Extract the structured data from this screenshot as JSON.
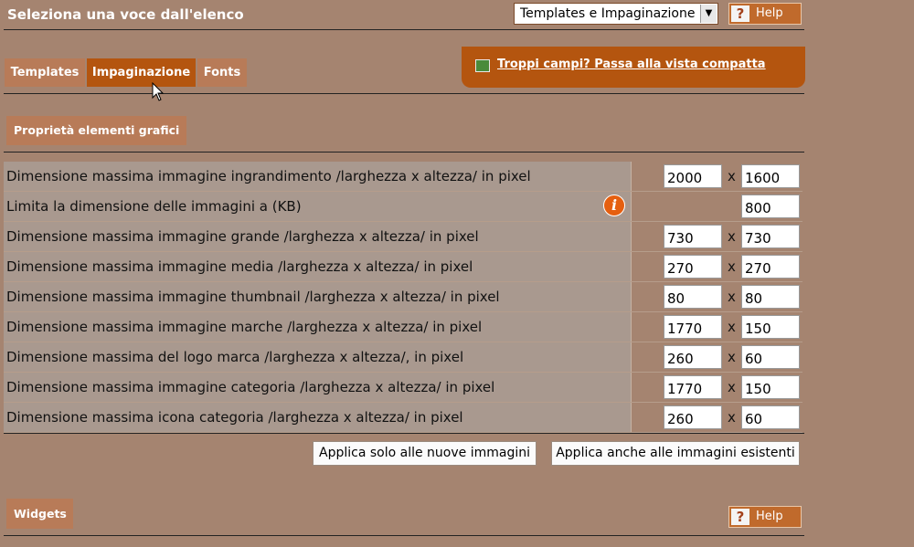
{
  "header": {
    "title": "Seleziona una voce dall'elenco",
    "select_value": "Templates e Impaginazione",
    "help_label": "Help",
    "help_q": "?"
  },
  "tabs": [
    {
      "label": "Templates",
      "active": false
    },
    {
      "label": "Impaginazione",
      "active": true
    },
    {
      "label": "Fonts",
      "active": false
    }
  ],
  "compact_view": {
    "link_text": "Troppi campi? Passa alla vista compatta"
  },
  "properties": {
    "section_title": "Proprietà elementi grafici",
    "times_sign": "x",
    "info_glyph": "i",
    "rows": [
      {
        "label": "Dimensione massima immagine ingrandimento /larghezza x altezza/ in pixel",
        "width": "2000",
        "height": "1600"
      },
      {
        "label": "Limita la dimensione delle immagini a (KB)",
        "width": "",
        "height": "800",
        "info": true
      },
      {
        "label": "Dimensione massima immagine grande /larghezza x altezza/ in pixel",
        "width": "730",
        "height": "730"
      },
      {
        "label": "Dimensione massima immagine media /larghezza x altezza/ in pixel",
        "width": "270",
        "height": "270"
      },
      {
        "label": "Dimensione massima immagine thumbnail /larghezza x altezza/ in pixel",
        "width": "80",
        "height": "80"
      },
      {
        "label": "Dimensione massima immagine marche /larghezza x altezza/ in pixel",
        "width": "1770",
        "height": "150"
      },
      {
        "label": "Dimensione massima del logo marca /larghezza x altezza/, in pixel",
        "width": "260",
        "height": "60"
      },
      {
        "label": "Dimensione massima immagine categoria /larghezza x altezza/ in pixel",
        "width": "1770",
        "height": "150"
      },
      {
        "label": "Dimensione massima icona categoria /larghezza x altezza/ in pixel",
        "width": "260",
        "height": "60"
      }
    ]
  },
  "buttons": {
    "apply_new": "Applica solo alle nuove immagini",
    "apply_all": "Applica anche alle immagini esistenti"
  },
  "widgets": {
    "section_title": "Widgets"
  },
  "colors": {
    "background": "#a58470",
    "accent": "#b4550f",
    "tab": "#b87b58",
    "info": "#e55f10"
  }
}
